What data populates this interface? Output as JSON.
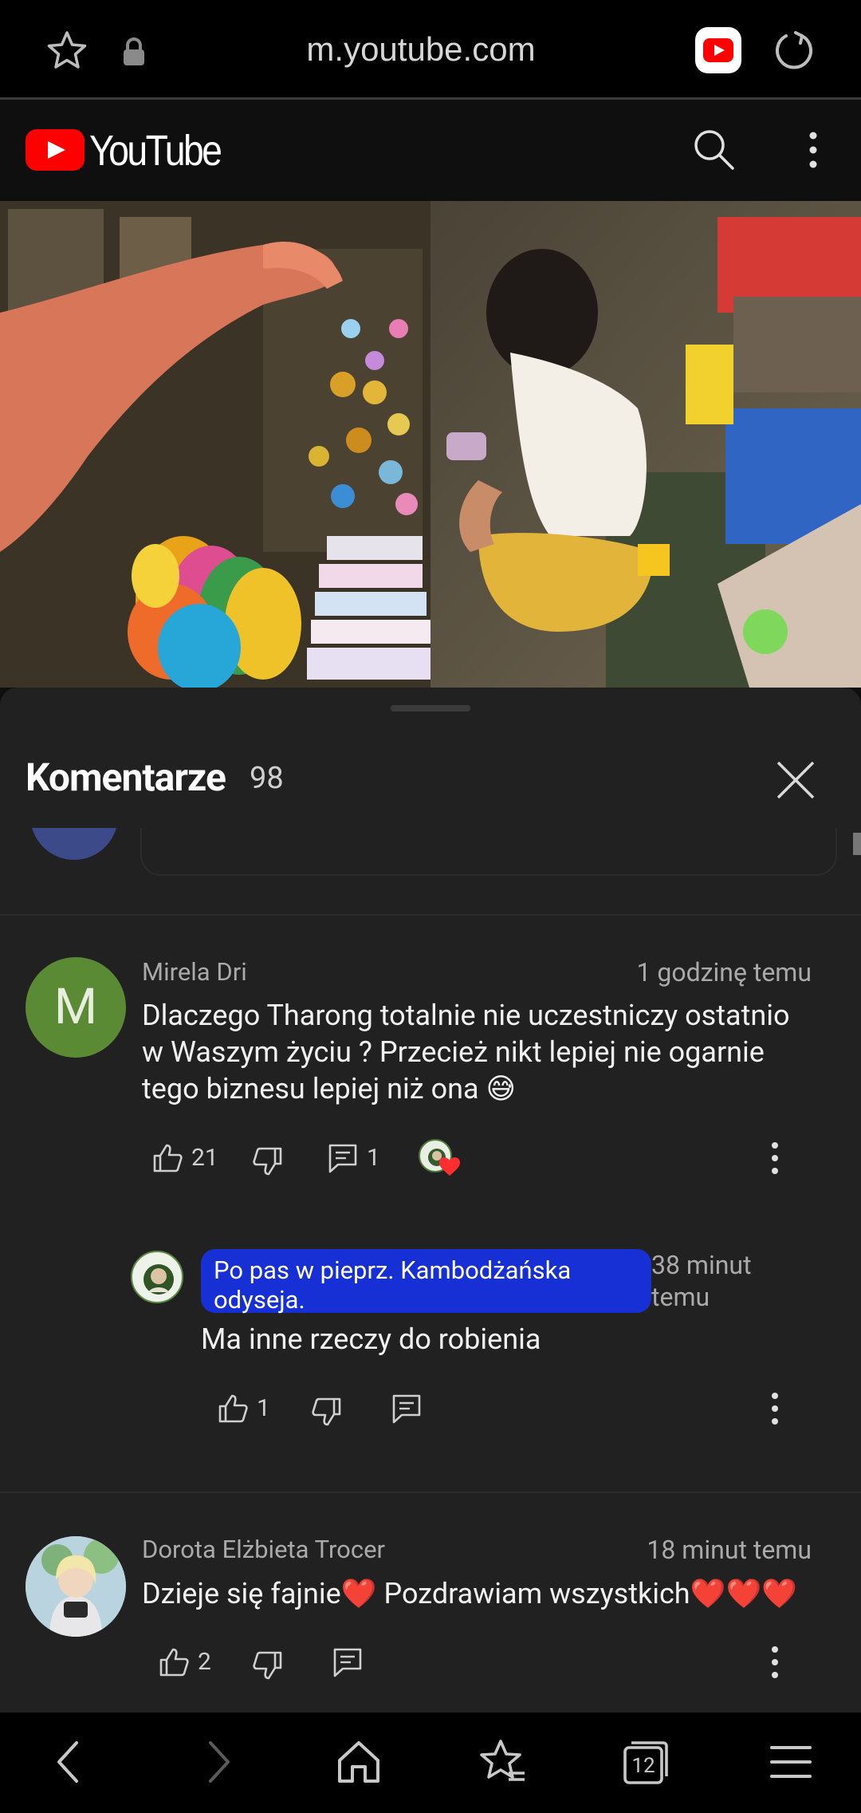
{
  "browser": {
    "url": "m.youtube.com"
  },
  "youtube": {
    "logo_text": "YouTube"
  },
  "comments_panel": {
    "title": "Komentarze",
    "count": "98",
    "comments": [
      {
        "author": "Mirela Dri",
        "avatar_letter": "M",
        "avatar_color": "#5a8a33",
        "time": "1 godzinę temu",
        "text_lines": [
          "Dlaczego Tharong totalnie nie uczestniczy ostatnio",
          "w Waszym życiu ? Przecież nikt lepiej nie ogarnie",
          "tego biznesu lepiej niż ona 😅"
        ],
        "likes": "21",
        "replies": "1",
        "reply": {
          "author": "Po pas w pieprz. Kambodżańska odyseja.",
          "author_lines": [
            "Po pas w pieprz. Kambodżańska",
            "odyseja."
          ],
          "time_lines": [
            "38 minut",
            "temu"
          ],
          "text": "Ma inne rzeczy do robienia",
          "likes": "1"
        }
      },
      {
        "author": "Dorota Elżbieta Trocer",
        "time": "18 minut temu",
        "text": "Dzieje się fajnie❤️ Pozdrawiam wszystkich❤️❤️❤️",
        "likes": "2"
      }
    ]
  },
  "colors": {
    "youtube_red": "#ff0000",
    "panel_bg": "#212121",
    "creator_chip": "#1630d6",
    "heart": "#ff2d2d"
  },
  "icons": [
    "star-icon",
    "lock-icon",
    "youtube-app-icon",
    "reload-icon",
    "search-icon",
    "more-vert-icon",
    "close-icon",
    "thumb-up-icon",
    "thumb-down-icon",
    "reply-icon",
    "back-icon",
    "forward-icon",
    "home-icon",
    "bookmarks-icon",
    "tabs-icon",
    "menu-icon"
  ],
  "bottom_nav": {
    "tabs_count": "12"
  }
}
